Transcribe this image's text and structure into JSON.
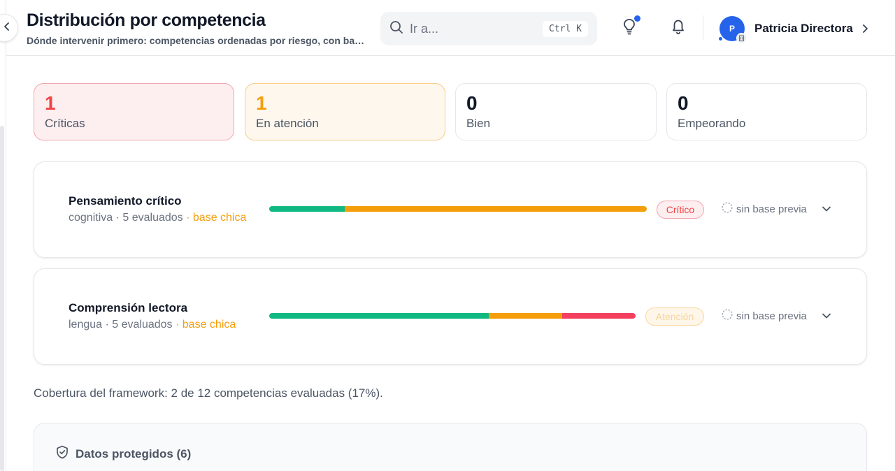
{
  "header": {
    "title": "Distribución por competencia",
    "subtitle": "Dónde intervenir primero: competencias ordenadas por riesgo, con base de evaluaciones y tendencia",
    "search": {
      "placeholder": "Ir a...",
      "shortcut": "Ctrl K"
    },
    "user": {
      "initial": "P",
      "name": "Patricia Directora"
    },
    "icons": {
      "collapse": "chevron-left-icon",
      "search": "search-icon",
      "tips": "lightbulb-icon",
      "notifications": "bell-icon",
      "user_menu": "chevron-right-icon"
    },
    "notification_dot_color": "#2563eb"
  },
  "stats": [
    {
      "value": "1",
      "label": "Críticas",
      "tone": "critical"
    },
    {
      "value": "1",
      "label": "En atención",
      "tone": "warning"
    },
    {
      "value": "0",
      "label": "Bien",
      "tone": "neutral"
    },
    {
      "value": "0",
      "label": "Empeorando",
      "tone": "neutral"
    }
  ],
  "competencies": [
    {
      "name": "Pensamiento crítico",
      "area": "cognitiva",
      "evaluated": "5 evaluados",
      "base_note": "base chica",
      "distribution": {
        "bien": 0.2,
        "atencion": 0.8,
        "critico": 0.0
      },
      "status": "Crítico",
      "trend": "sin base previa"
    },
    {
      "name": "Comprensión lectora",
      "area": "lengua",
      "evaluated": "5 evaluados",
      "base_note": "base chica",
      "distribution": {
        "bien": 0.6,
        "atencion": 0.2,
        "critico": 0.2
      },
      "status": "Atención",
      "trend": "sin base previa"
    }
  ],
  "colors": {
    "bien": "#10b981",
    "atencion": "#f59e0b",
    "critico": "#f43f5e"
  },
  "coverage_text": "Cobertura del framework: 2 de 12 competencias evaluadas (17%).",
  "protected": {
    "title": "Datos protegidos (6)",
    "icon": "shield-check-icon"
  }
}
